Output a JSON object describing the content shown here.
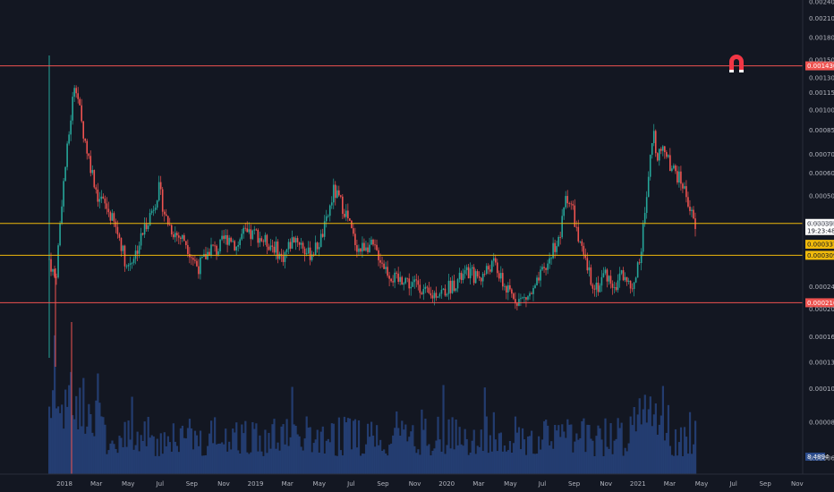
{
  "colors": {
    "background": "#131722",
    "up": "#26a69a",
    "down": "#ef5350",
    "volume": "#2a4a8a",
    "support": "#f0b90b",
    "resistance": "#ef5350",
    "axis_text": "#b2b5be",
    "logo": "#f23645"
  },
  "logo": {
    "icon": "magnet-icon"
  },
  "chart_data": {
    "type": "candlestick",
    "x_axis": {
      "labels": [
        "2018",
        "Mar",
        "May",
        "Jul",
        "Sep",
        "Nov",
        "2019",
        "Mar",
        "May",
        "Jul",
        "Sep",
        "Nov",
        "2020",
        "Mar",
        "May",
        "Jul",
        "Sep",
        "Nov",
        "2021",
        "Mar",
        "May",
        "Jul",
        "Sep",
        "Nov"
      ]
    },
    "y_axis": {
      "scale": "log",
      "ticks": [
        "0.00240000",
        "0.00210000",
        "0.00180000",
        "0.00150000",
        "0.00130000",
        "0.00115000",
        "0.00100000",
        "0.00085000",
        "0.00070000",
        "0.00060000",
        "0.00050000",
        "0.00040000",
        "0.00024000",
        "0.00020000",
        "0.00016000",
        "0.00013000",
        "0.00010500",
        "0.00008000",
        "0.00006000"
      ],
      "tick_values": [
        0.0024,
        0.0021,
        0.0018,
        0.0015,
        0.0013,
        0.00115,
        0.001,
        0.00085,
        0.0007,
        0.0006,
        0.0005,
        0.0004,
        0.00024,
        0.0002,
        0.00016,
        0.00013,
        0.000105,
        8e-05,
        6e-05
      ]
    },
    "horizontal_levels": [
      {
        "value": 0.00143,
        "label": "0.00143000",
        "kind": "resistance"
      },
      {
        "value": 0.00039989,
        "label": "0.00039989",
        "kind": "support"
      },
      {
        "value": 0.00030906,
        "label": "0.00030906",
        "kind": "support"
      },
      {
        "value": 0.00021056,
        "label": "0.00021056",
        "kind": "resistance"
      }
    ],
    "current_price": {
      "value": 0.00039989,
      "label": "0.00039989",
      "countdown": "19:23:48"
    },
    "marked_price": {
      "value": 0.00033777,
      "label": "0.00033777"
    },
    "volume_axis_label": "8.4894",
    "price_path": [
      [
        0,
        0.0003
      ],
      [
        0.01,
        0.00025
      ],
      [
        0.02,
        0.0005
      ],
      [
        0.03,
        0.0008
      ],
      [
        0.04,
        0.0013
      ],
      [
        0.05,
        0.0009
      ],
      [
        0.06,
        0.0007
      ],
      [
        0.075,
        0.0005
      ],
      [
        0.09,
        0.00045
      ],
      [
        0.1,
        0.0004
      ],
      [
        0.11,
        0.00035
      ],
      [
        0.12,
        0.00028
      ],
      [
        0.135,
        0.00032
      ],
      [
        0.15,
        0.0004
      ],
      [
        0.16,
        0.00045
      ],
      [
        0.17,
        0.00053
      ],
      [
        0.18,
        0.00042
      ],
      [
        0.19,
        0.00038
      ],
      [
        0.2,
        0.00036
      ],
      [
        0.21,
        0.00035
      ],
      [
        0.22,
        0.00031
      ],
      [
        0.23,
        0.00028
      ],
      [
        0.24,
        0.0003
      ],
      [
        0.25,
        0.00033
      ],
      [
        0.26,
        0.00032
      ],
      [
        0.27,
        0.00035
      ],
      [
        0.28,
        0.00036
      ],
      [
        0.29,
        0.00033
      ],
      [
        0.3,
        0.00037
      ],
      [
        0.31,
        0.00036
      ],
      [
        0.32,
        0.00037
      ],
      [
        0.33,
        0.00035
      ],
      [
        0.34,
        0.00034
      ],
      [
        0.35,
        0.00033
      ],
      [
        0.36,
        0.0003
      ],
      [
        0.37,
        0.00033
      ],
      [
        0.38,
        0.00036
      ],
      [
        0.39,
        0.00034
      ],
      [
        0.4,
        0.00031
      ],
      [
        0.41,
        0.00032
      ],
      [
        0.42,
        0.00035
      ],
      [
        0.43,
        0.00041
      ],
      [
        0.44,
        0.00052
      ],
      [
        0.45,
        0.00048
      ],
      [
        0.46,
        0.00043
      ],
      [
        0.47,
        0.00036
      ],
      [
        0.48,
        0.00032
      ],
      [
        0.49,
        0.00034
      ],
      [
        0.5,
        0.00033
      ],
      [
        0.51,
        0.00031
      ],
      [
        0.52,
        0.00028
      ],
      [
        0.53,
        0.00026
      ],
      [
        0.54,
        0.00025
      ],
      [
        0.55,
        0.00026
      ],
      [
        0.56,
        0.00024
      ],
      [
        0.57,
        0.00025
      ],
      [
        0.58,
        0.00023
      ],
      [
        0.59,
        0.00022
      ],
      [
        0.6,
        0.00023
      ],
      [
        0.61,
        0.00023
      ],
      [
        0.62,
        0.00024
      ],
      [
        0.63,
        0.00025
      ],
      [
        0.64,
        0.00026
      ],
      [
        0.65,
        0.00027
      ],
      [
        0.66,
        0.00026
      ],
      [
        0.67,
        0.00026
      ],
      [
        0.68,
        0.00028
      ],
      [
        0.69,
        0.00029
      ],
      [
        0.7,
        0.00025
      ],
      [
        0.71,
        0.00023
      ],
      [
        0.72,
        0.00022
      ],
      [
        0.73,
        0.000215
      ],
      [
        0.74,
        0.00022
      ],
      [
        0.75,
        0.00023
      ],
      [
        0.76,
        0.00026
      ],
      [
        0.77,
        0.00028
      ],
      [
        0.78,
        0.00033
      ],
      [
        0.79,
        0.00035
      ],
      [
        0.8,
        0.00051
      ],
      [
        0.81,
        0.00045
      ],
      [
        0.82,
        0.00034
      ],
      [
        0.83,
        0.00029
      ],
      [
        0.84,
        0.00025
      ],
      [
        0.85,
        0.00024
      ],
      [
        0.86,
        0.00027
      ],
      [
        0.87,
        0.00025
      ],
      [
        0.88,
        0.00024
      ],
      [
        0.885,
        0.00028
      ],
      [
        0.89,
        0.00025
      ],
      [
        0.895,
        0.00026
      ],
      [
        0.9,
        0.00023
      ],
      [
        0.905,
        0.00024
      ],
      [
        0.91,
        0.00028
      ],
      [
        0.915,
        0.00031
      ],
      [
        0.92,
        0.0004
      ],
      [
        0.925,
        0.00048
      ],
      [
        0.93,
        0.00065
      ],
      [
        0.935,
        0.00085
      ],
      [
        0.94,
        0.0007
      ],
      [
        0.95,
        0.00075
      ],
      [
        0.96,
        0.00065
      ],
      [
        0.97,
        0.0006
      ],
      [
        0.98,
        0.00055
      ],
      [
        0.99,
        0.00047
      ],
      [
        1.0,
        0.00038
      ]
    ]
  }
}
